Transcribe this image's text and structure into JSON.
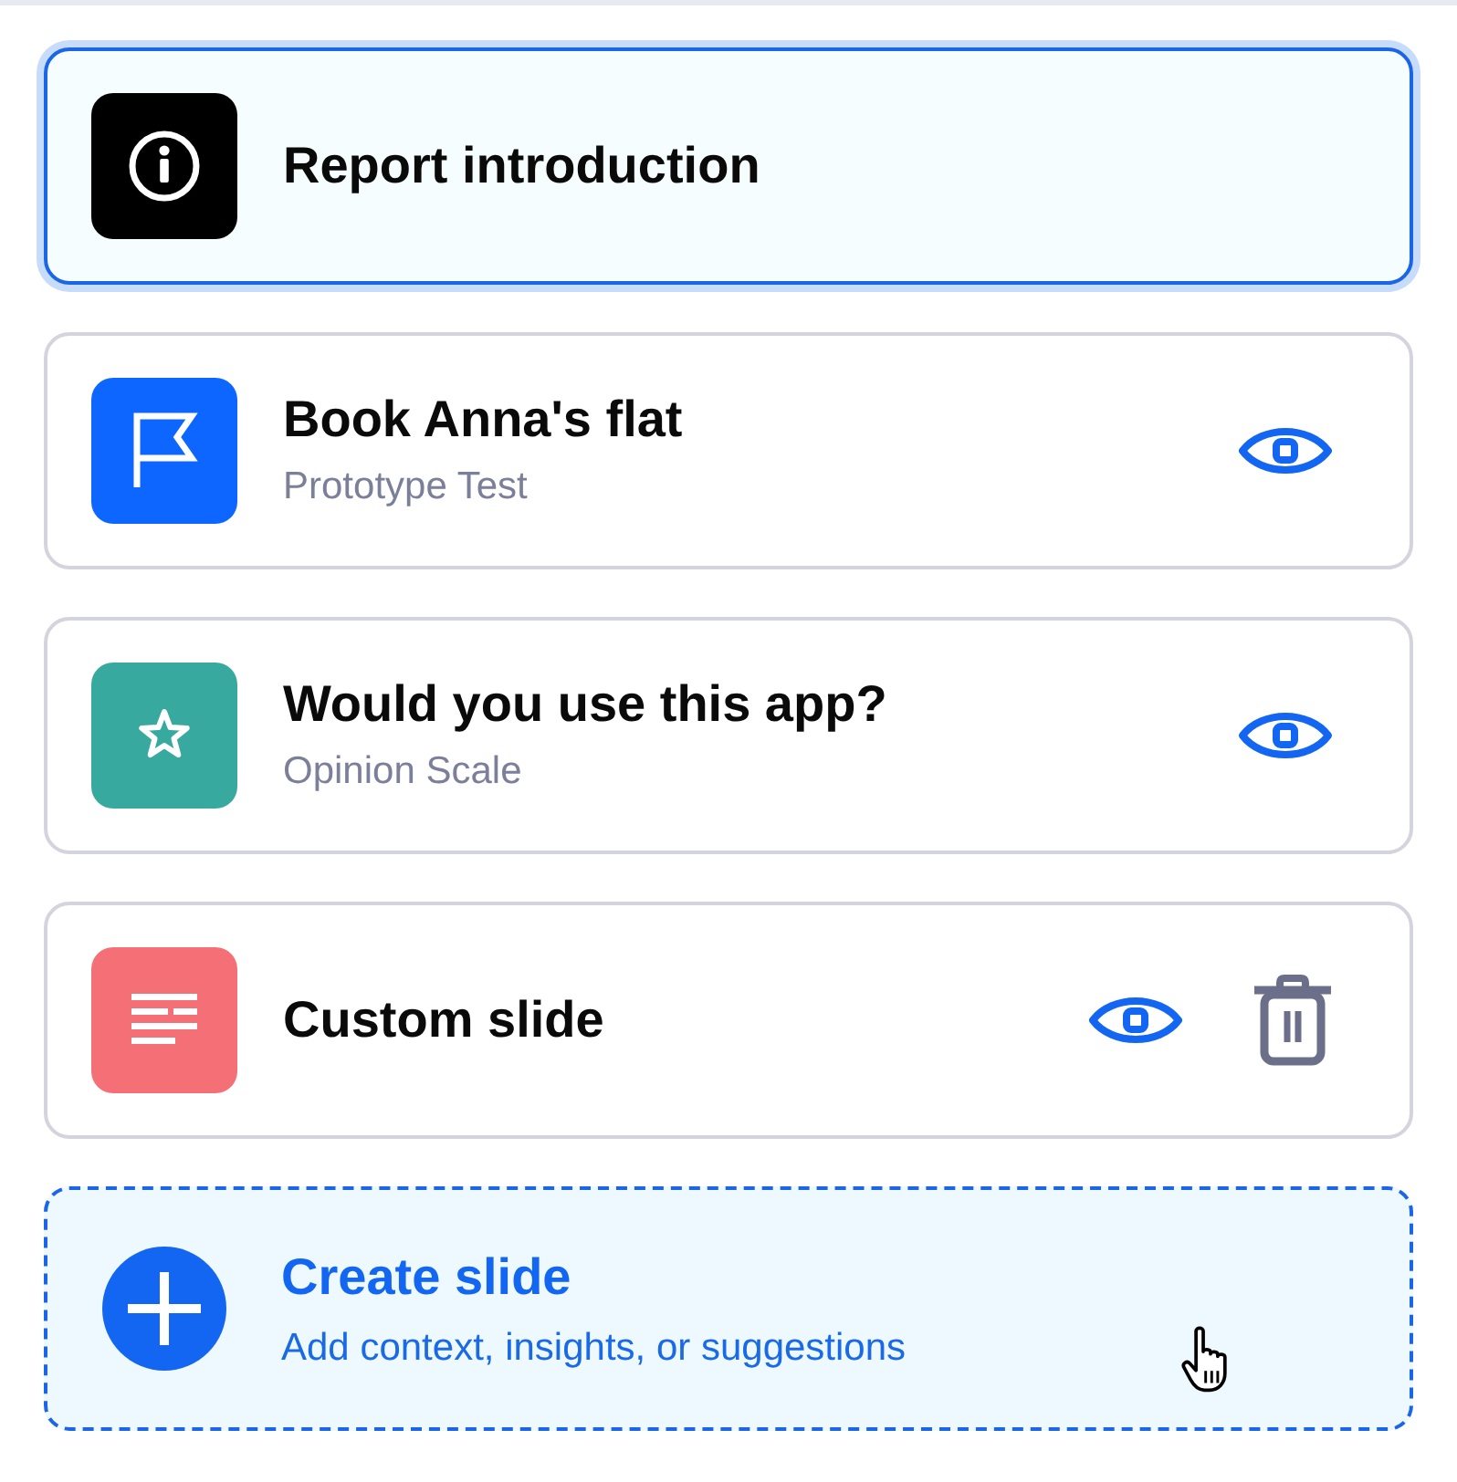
{
  "slides": [
    {
      "kind": "info",
      "color": "#000000",
      "title": "Report introduction",
      "selected": true
    },
    {
      "kind": "flag",
      "color": "#0d66ff",
      "title": "Book Anna's flat",
      "subtitle": "Prototype Test",
      "selected": false,
      "actions": [
        {
          "kind": "preview"
        }
      ]
    },
    {
      "kind": "star",
      "color": "#38a99e",
      "title": "Would you use this app?",
      "subtitle": "Opinion Scale",
      "selected": false,
      "actions": [
        {
          "kind": "preview"
        }
      ]
    },
    {
      "kind": "text",
      "color": "#f56f76",
      "title": "Custom slide",
      "selected": false,
      "actions": [
        {
          "kind": "preview"
        },
        {
          "kind": "delete"
        }
      ]
    }
  ],
  "create": {
    "title": "Create slide",
    "description": "Add context, insights, or suggestions",
    "hovered": true
  }
}
